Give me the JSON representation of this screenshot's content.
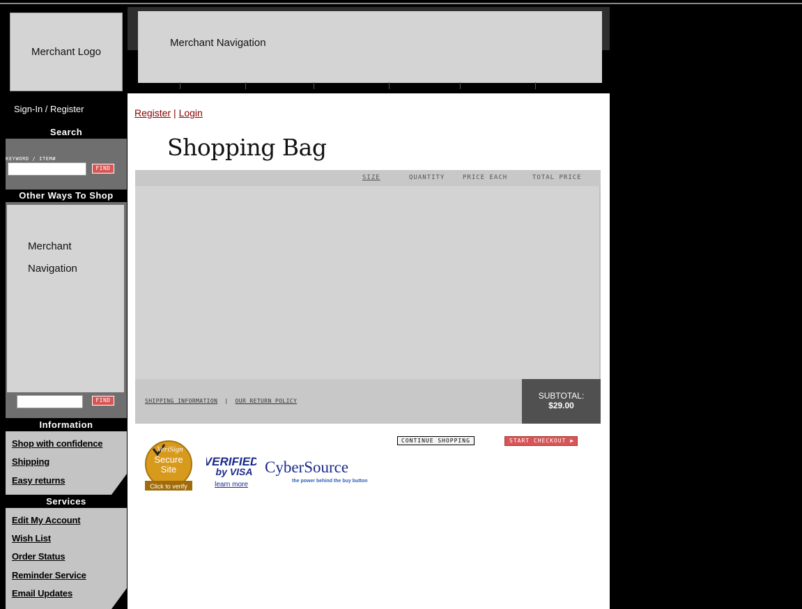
{
  "header": {
    "logo_text": "Merchant Logo",
    "nav_text": "Merchant Navigation"
  },
  "sidebar": {
    "signin": "Sign-In / Register",
    "search_heading": "Search",
    "keyword_label": "KEYWORD / ITEM#",
    "find_label": "FIND",
    "other_ways_heading": "Other Ways To Shop",
    "nav_line1": "Merchant",
    "nav_line2": "Navigation",
    "find_label_2": "FIND",
    "information_heading": "Information",
    "information_links": [
      "Shop with confidence",
      "Shipping",
      "Easy returns"
    ],
    "services_heading": "Services",
    "services_links": [
      "Edit My Account",
      "Wish List",
      "Order Status",
      "Reminder Service",
      "Email Updates"
    ]
  },
  "main": {
    "register": "Register",
    "separator": "|",
    "login": "Login",
    "title": "Shopping Bag",
    "columns": {
      "size": "SIZE",
      "quantity": "QUANTITY",
      "price_each": "PRICE EACH",
      "total_price": "TOTAL PRICE"
    },
    "shipping_info": "SHIPPING INFORMATION",
    "link_sep": "|",
    "return_policy": "OUR RETURN POLICY",
    "subtotal_label": "SUBTOTAL:",
    "subtotal_value": "$29.00",
    "continue_shopping": "CONTINUE SHOPPING",
    "start_checkout": "START CHECKOUT"
  },
  "badges": {
    "verisign": {
      "brand": "VeriSign",
      "line1": "Secure",
      "line2": "Site",
      "verify": "Click to verify"
    },
    "visa": {
      "line1": "VERIFIED",
      "line2": "by VISA",
      "learn": "learn more"
    },
    "cybersource": {
      "brand": "CyberSource",
      "tagline": "the power behind the buy button"
    }
  },
  "colors": {
    "accent_red": "#d85555",
    "link_dark_red": "#880000",
    "panel_gray": "#d4d4d4"
  }
}
